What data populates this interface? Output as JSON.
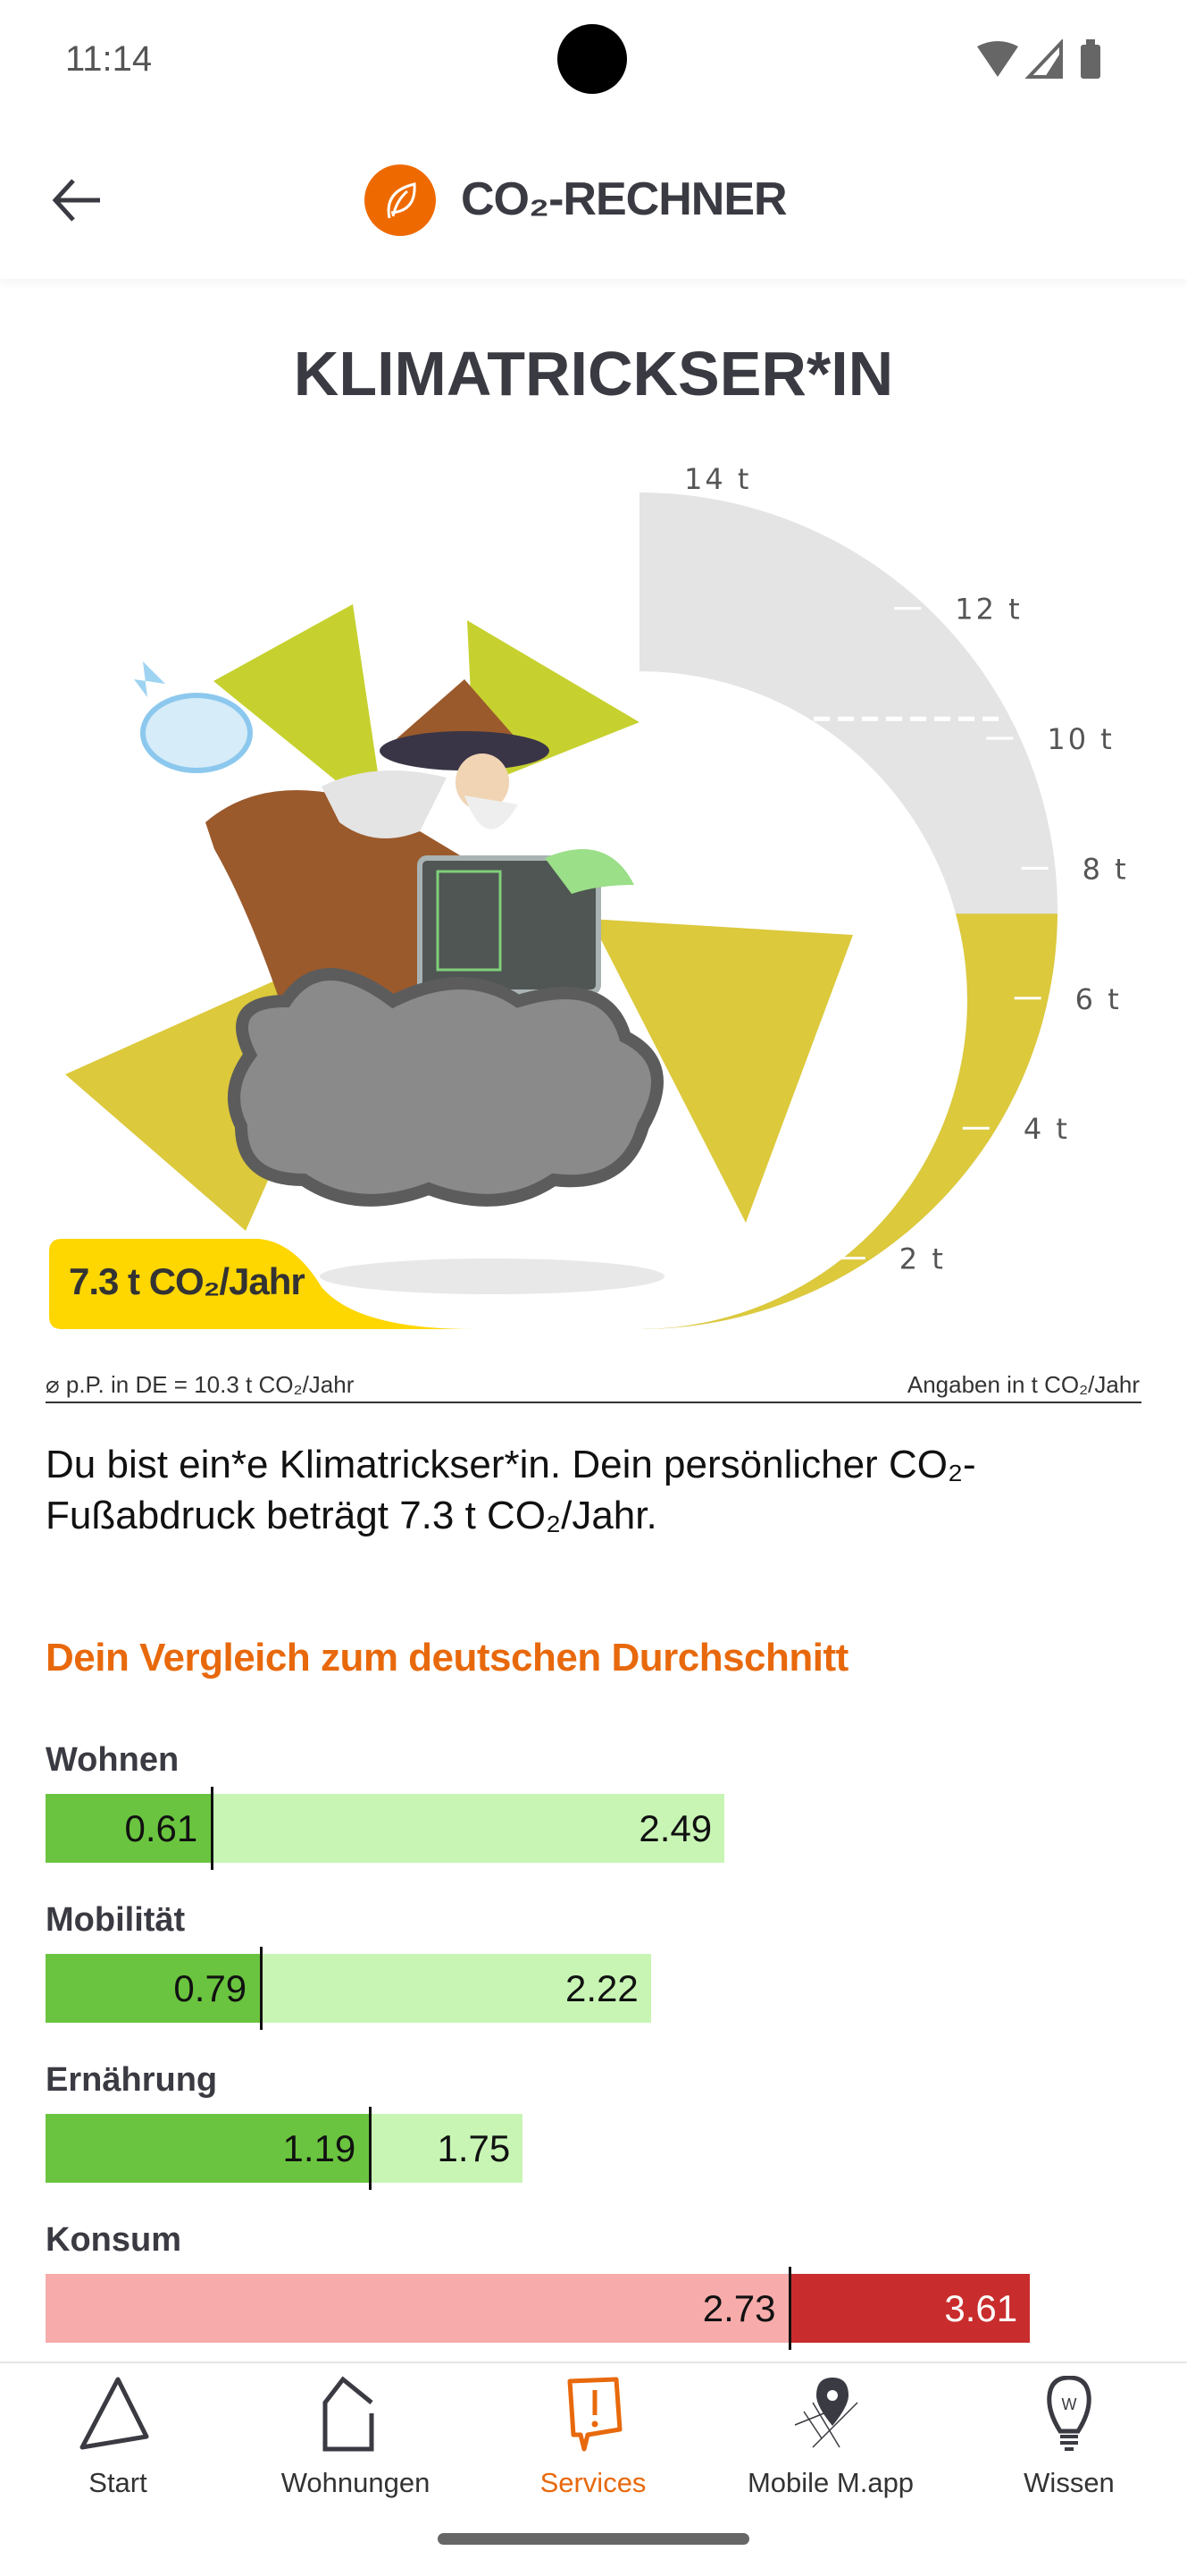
{
  "status_bar": {
    "time": "11:14",
    "icons": [
      "wifi-icon",
      "signal-icon",
      "battery-icon"
    ]
  },
  "header": {
    "title": "CO₂-RECHNER",
    "logo_icon": "leaf-icon",
    "back_icon": "arrow-left-icon",
    "accent": "#ee6a00"
  },
  "result": {
    "title": "KLIMATRICKSER*IN",
    "badge": "7.3 t CO₂/Jahr",
    "average_note": "⌀ p.P. in DE = 10.3 t CO₂/Jahr",
    "unit_note": "Angaben in t CO₂/Jahr",
    "description": "Du bist ein*e Klimatrickser*in. Dein persönlicher CO₂-Fußabdruck beträgt 7.3 t CO₂/Jahr."
  },
  "chart_data": [
    {
      "type": "gauge",
      "value": 7.3,
      "reference": 10.3,
      "range": [
        0,
        14
      ],
      "tick_labels": [
        "2 t",
        "4 t",
        "6 t",
        "8 t",
        "10 t",
        "12 t",
        "14 t"
      ],
      "ticks": [
        2,
        4,
        6,
        8,
        10,
        12,
        14
      ],
      "colors": {
        "fill": "#dcc93c",
        "track": "#e4e4e4"
      }
    },
    {
      "type": "bar",
      "title": "Dein Vergleich zum deutschen Durchschnitt",
      "rows": [
        {
          "label": "Wohnen",
          "you": 0.61,
          "avg": 2.49,
          "you_text": "0.61",
          "avg_text": "2.49"
        },
        {
          "label": "Mobilität",
          "you": 0.79,
          "avg": 2.22,
          "you_text": "0.79",
          "avg_text": "2.22"
        },
        {
          "label": "Ernährung",
          "you": 1.19,
          "avg": 1.75,
          "you_text": "1.19",
          "avg_text": "1.75"
        },
        {
          "label": "Konsum",
          "you": 3.61,
          "avg": 2.73,
          "you_text": "3.61",
          "avg_text": "2.73"
        }
      ],
      "colors": {
        "below_dark": "#6ac43f",
        "below_light": "#c8f5b4",
        "above_light": "#f7abab",
        "above_dark": "#c92c2c"
      }
    }
  ],
  "nav": {
    "items": [
      {
        "label": "Start",
        "icon": "triangle-icon",
        "active": false
      },
      {
        "label": "Wohnungen",
        "icon": "house-icon",
        "active": false
      },
      {
        "label": "Services",
        "icon": "speech-bubble-exclamation-icon",
        "active": true
      },
      {
        "label": "Mobile M.app",
        "icon": "map-pin-icon",
        "active": false
      },
      {
        "label": "Wissen",
        "icon": "lightbulb-icon",
        "active": false
      }
    ],
    "active_color": "#e8690c"
  }
}
